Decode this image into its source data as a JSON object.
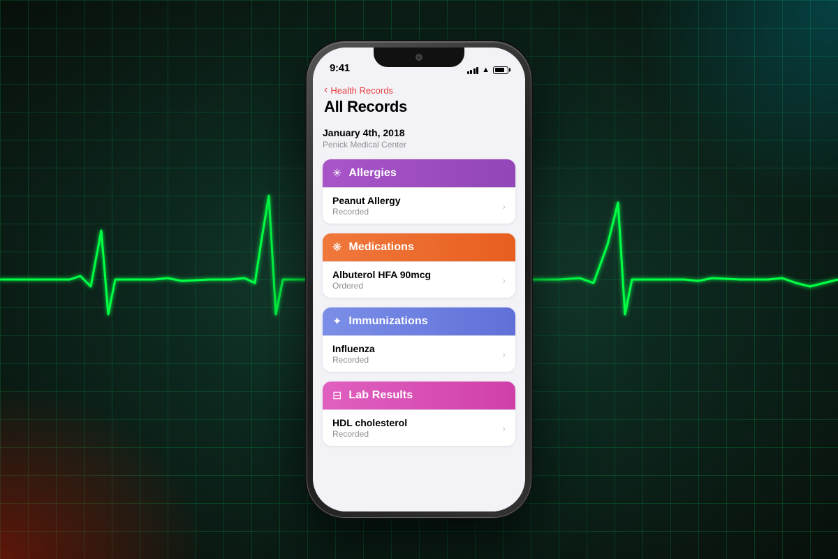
{
  "background": {
    "grid_color": "rgba(0,255,100,0.15)"
  },
  "status_bar": {
    "time": "9:41",
    "signal_label": "signal",
    "wifi_label": "wifi",
    "battery_label": "battery"
  },
  "navigation": {
    "back_label": "Health Records",
    "title": "All Records"
  },
  "record": {
    "date": "January 4th, 2018",
    "facility": "Penick Medical Center"
  },
  "categories": [
    {
      "id": "allergies",
      "label": "Allergies",
      "icon": "✳",
      "color_class": "allergies-header",
      "items": [
        {
          "name": "Peanut Allergy",
          "status": "Recorded"
        }
      ]
    },
    {
      "id": "medications",
      "label": "Medications",
      "icon": "❋",
      "color_class": "medications-header",
      "items": [
        {
          "name": "Albuterol HFA 90mcg",
          "status": "Ordered"
        }
      ]
    },
    {
      "id": "immunizations",
      "label": "Immunizations",
      "icon": "⚕",
      "color_class": "immunizations-header",
      "items": [
        {
          "name": "Influenza",
          "status": "Recorded"
        }
      ]
    },
    {
      "id": "lab-results",
      "label": "Lab Results",
      "icon": "⚗",
      "color_class": "labresults-header",
      "items": [
        {
          "name": "HDL cholesterol",
          "status": "Recorded"
        }
      ]
    }
  ]
}
